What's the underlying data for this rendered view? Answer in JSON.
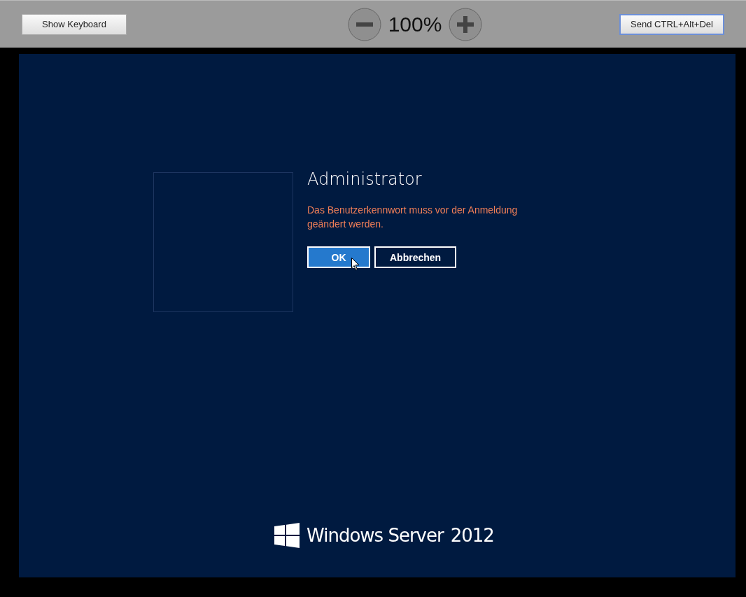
{
  "toolbar": {
    "buttons": [
      {
        "label": "Show Keyboard",
        "focused": false
      },
      {
        "label": "Send CTRL+Alt+Del",
        "focused": true
      }
    ],
    "zoom": {
      "value": "100%"
    }
  },
  "login": {
    "user": "Administrator",
    "message": "Das Benutzerkennwort muss vor der Anmeldung geändert werden.",
    "buttons": [
      {
        "label": "OK",
        "selected": true
      },
      {
        "label": "Abbrechen",
        "selected": false
      }
    ]
  },
  "logo": {
    "text": "Windows Server",
    "version": "2012"
  }
}
